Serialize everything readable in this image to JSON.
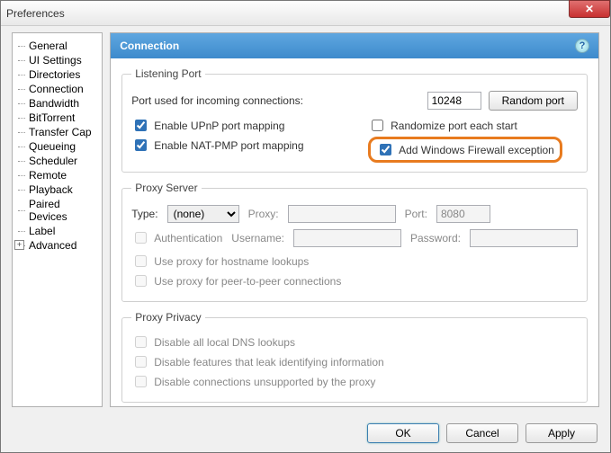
{
  "window": {
    "title": "Preferences"
  },
  "sidebar": {
    "items": [
      "General",
      "UI Settings",
      "Directories",
      "Connection",
      "Bandwidth",
      "BitTorrent",
      "Transfer Cap",
      "Queueing",
      "Scheduler",
      "Remote",
      "Playback",
      "Paired Devices",
      "Label",
      "Advanced"
    ]
  },
  "header": {
    "title": "Connection"
  },
  "listening": {
    "legend": "Listening Port",
    "port_label": "Port used for incoming connections:",
    "port_value": "10248",
    "random_btn": "Random port",
    "upnp": "Enable UPnP port mapping",
    "nat": "Enable NAT-PMP port mapping",
    "randomize": "Randomize port each start",
    "firewall": "Add Windows Firewall exception"
  },
  "proxy": {
    "legend": "Proxy Server",
    "type_label": "Type:",
    "type_value": "(none)",
    "proxy_label": "Proxy:",
    "port_label": "Port:",
    "port_value": "8080",
    "auth": "Authentication",
    "user_label": "Username:",
    "pass_label": "Password:",
    "hostname": "Use proxy for hostname lookups",
    "p2p": "Use proxy for peer-to-peer connections"
  },
  "privacy": {
    "legend": "Proxy Privacy",
    "dns": "Disable all local DNS lookups",
    "leak": "Disable features that leak identifying information",
    "unsupported": "Disable connections unsupported by the proxy"
  },
  "footer": {
    "ok": "OK",
    "cancel": "Cancel",
    "apply": "Apply"
  }
}
